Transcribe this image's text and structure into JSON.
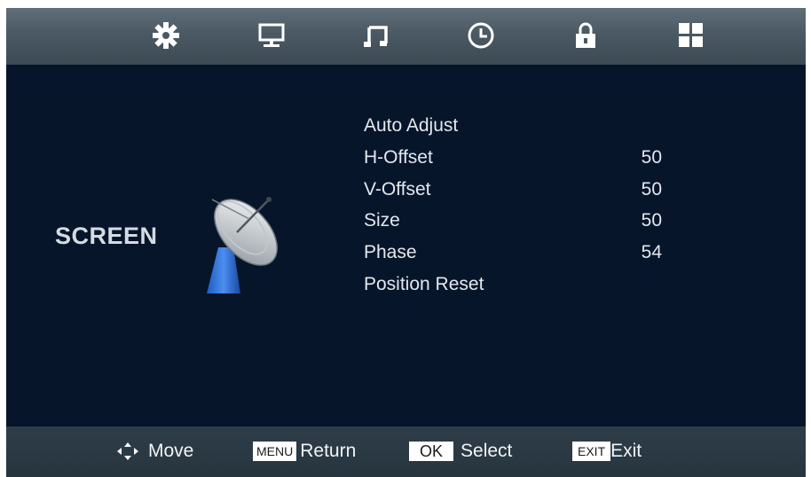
{
  "top_tabs": [
    {
      "icon": "picture-gear-icon"
    },
    {
      "icon": "monitor-icon"
    },
    {
      "icon": "music-note-icon"
    },
    {
      "icon": "clock-icon"
    },
    {
      "icon": "lock-icon"
    },
    {
      "icon": "grid-icon"
    }
  ],
  "section": {
    "title": "SCREEN",
    "icon": "satellite-dish-icon"
  },
  "menu": [
    {
      "label": "Auto Adjust",
      "value": ""
    },
    {
      "label": "H-Offset",
      "value": "50"
    },
    {
      "label": "V-Offset",
      "value": "50"
    },
    {
      "label": "Size",
      "value": "50"
    },
    {
      "label": "Phase",
      "value": "54"
    },
    {
      "label": "Position Reset",
      "value": ""
    }
  ],
  "footer": {
    "move_label": "Move",
    "menu_key": "MENU",
    "return_label": "Return",
    "ok_key": "OK",
    "select_label": "Select",
    "exit_key": "EXIT",
    "exit_label": "Exit"
  }
}
